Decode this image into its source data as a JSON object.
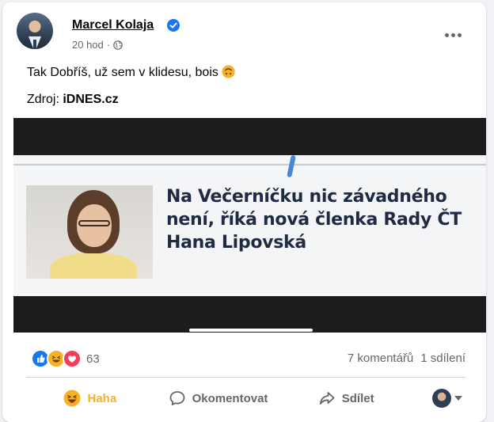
{
  "post": {
    "author": "Marcel Kolaja",
    "time": "20 hod",
    "separator": "·",
    "text": "Tak Dobříš, už sem v klidesu, bois",
    "source_prefix": "Zdroj:",
    "source_name": "iDNES.cz"
  },
  "image": {
    "headline": "Na Večerníčku nic závadného není, říká nová členka Rady ČT Hana Lipovská"
  },
  "stats": {
    "reaction_count": "63",
    "comments": "7 komentářů",
    "shares": "1 sdílení"
  },
  "actions": {
    "react_label": "Haha",
    "comment_label": "Okomentovat",
    "share_label": "Sdílet"
  },
  "colors": {
    "haha": "#f7b125",
    "like": "#1877f2",
    "love": "#f33e58",
    "secondary_text": "#65676b"
  }
}
